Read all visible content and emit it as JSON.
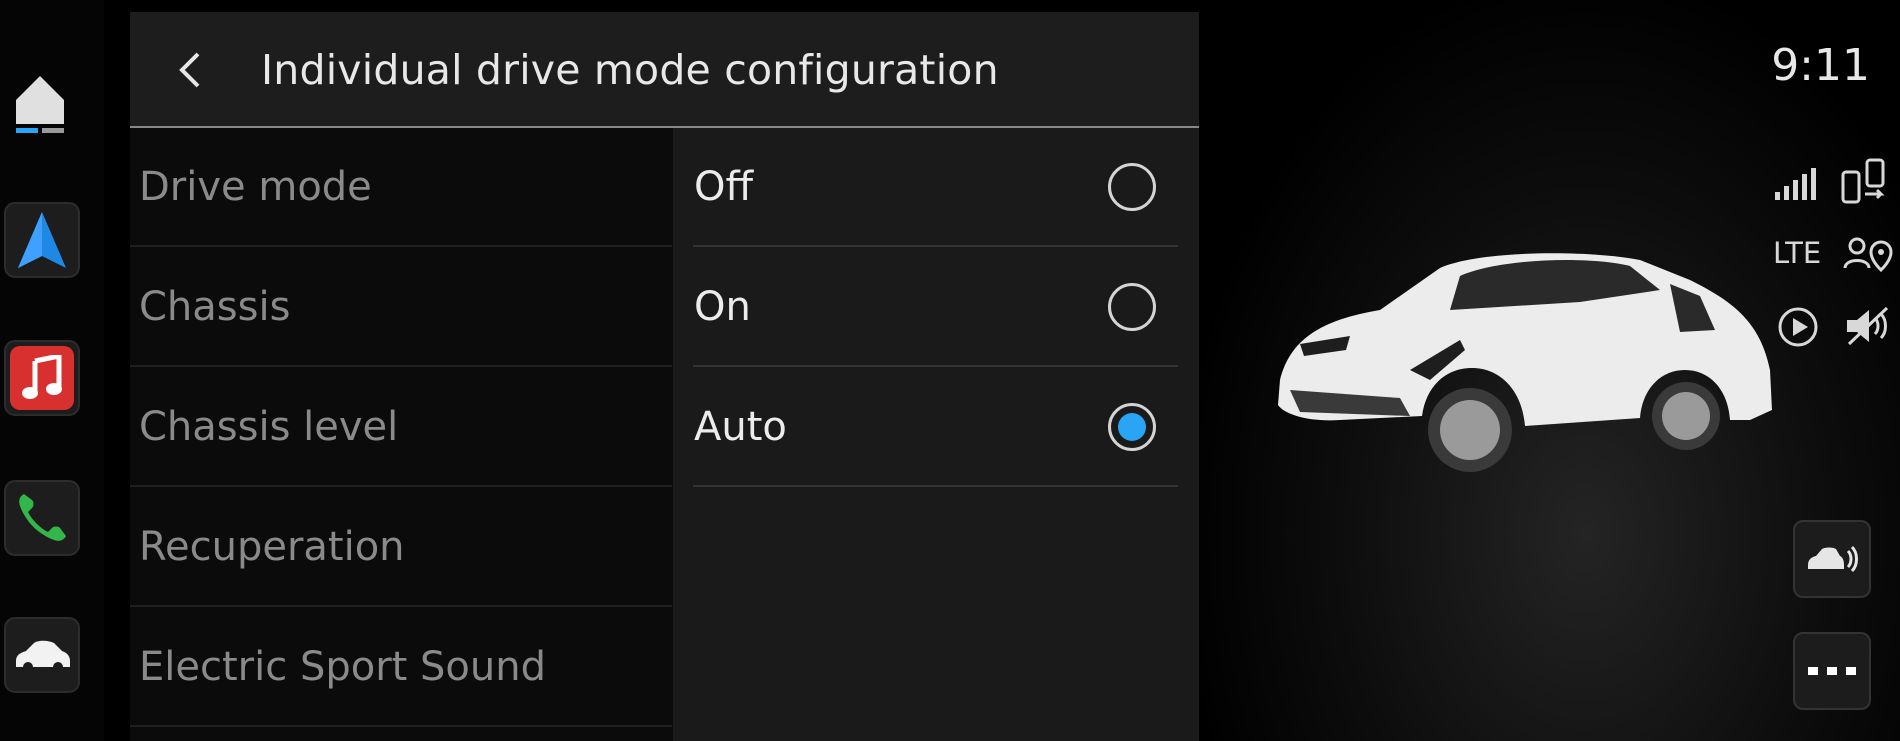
{
  "header": {
    "title": "Individual drive mode configuration"
  },
  "settings": [
    {
      "label": "Drive mode"
    },
    {
      "label": "Chassis"
    },
    {
      "label": "Chassis level"
    },
    {
      "label": "Recuperation"
    },
    {
      "label": "Electric Sport Sound"
    }
  ],
  "options": [
    {
      "label": "Off",
      "selected": false
    },
    {
      "label": "On",
      "selected": false
    },
    {
      "label": "Auto",
      "selected": true
    }
  ],
  "status": {
    "time": "9:11",
    "network": "LTE"
  },
  "dock": {
    "apps": [
      "home-icon",
      "navigation-icon",
      "music-icon",
      "phone-icon",
      "car-icon"
    ]
  },
  "colors": {
    "accent": "#2aa4f4",
    "nav": "#1e88e5",
    "music": "#d8302f",
    "phone": "#33b64a"
  },
  "icons": {
    "signal": "signal-bars-icon",
    "phone_link": "phone-link-icon",
    "user_location": "user-location-icon",
    "play": "play-circle-icon",
    "mute": "mute-icon",
    "park_assist": "park-assist-icon",
    "more": "more-icon"
  }
}
